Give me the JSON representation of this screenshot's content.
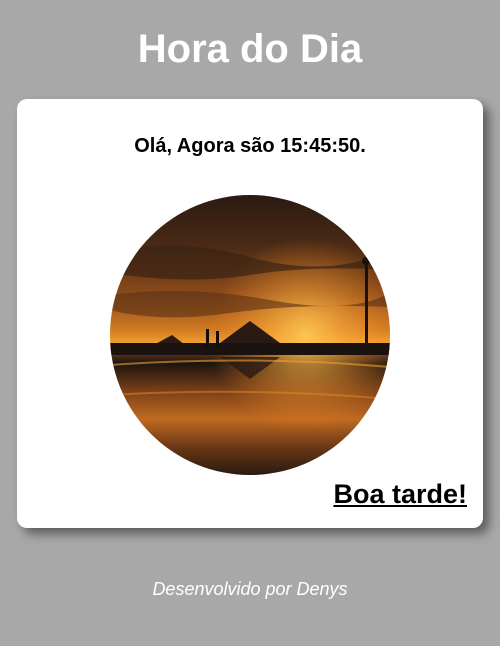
{
  "header": {
    "title": "Hora do Dia"
  },
  "card": {
    "greeting": "Olá, Agora são 15:45:50.",
    "salutation": "Boa tarde!",
    "image": {
      "subject": "sunset-beach-photo"
    }
  },
  "footer": {
    "credit": "Desenvolvido por Denys"
  },
  "colors": {
    "background": "#a8a8a8",
    "card": "#ffffff",
    "title_text": "#ffffff",
    "footer_text": "#ffffff"
  }
}
